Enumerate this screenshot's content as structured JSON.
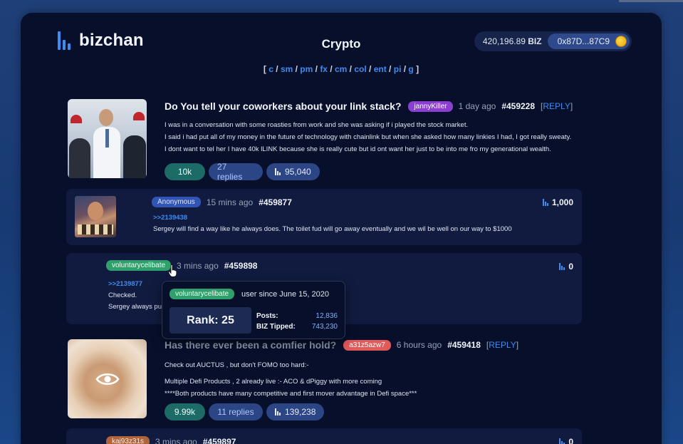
{
  "header": {
    "logo_text": "bizchan",
    "board_title": "Crypto",
    "nav": [
      "c",
      "sm",
      "pm",
      "fx",
      "cm",
      "col",
      "ent",
      "pi",
      "g"
    ],
    "wallet_balance": "420,196.89",
    "wallet_currency": "BIZ",
    "wallet_address": "0x87D...87C9"
  },
  "threads": [
    {
      "title": "Do You tell your coworkers about your link stack?",
      "author": "jannyKiller",
      "time": "1 day ago",
      "post_no": "#459228",
      "reply_label": "REPLY",
      "body": [
        "I was in a conversation with some roasties from work and she was asking if i played the stock market.",
        "I said i had put all of my money in the future of technology with chainlink but when she asked how many linkies I had, I got really sweaty.",
        "I dont want to tel her I have 40k lLINK because she is really cute but id ont want her just to be into me fro my generational wealth."
      ],
      "likes": "10k",
      "replies": "27 replies",
      "views": "95,040"
    },
    {
      "title": "Has there ever been a comfier hold?",
      "author": "a31z5azw7",
      "time": "6 hours ago",
      "post_no": "#459418",
      "reply_label": "REPLY",
      "body": [
        "Check out AUCTUS , but don't FOMO too hard:-",
        "",
        "Multiple Defi Products , 2 already live :- ACO & dPiggy with more coming",
        "****Both products have many competitive and first mover advantage in Defi space***"
      ],
      "likes": "9.99k",
      "replies": "11 replies",
      "views": "139,238"
    }
  ],
  "replies": [
    {
      "author": "Anonymous",
      "time": "15 mins ago",
      "post_no": "#459877",
      "quote": ">>2139438",
      "body": "Sergey will find a way like he always does. The toilet fud will go away eventually and we wil be well on our way to $1000",
      "views": "1,000"
    },
    {
      "author": "voluntarycelibate",
      "time": "3 mins ago",
      "post_no": "#459898",
      "quote": ">>2139877",
      "body_lines": [
        "Checked.",
        "Sergey always pul"
      ],
      "views": "0"
    },
    {
      "author": "kaj93z31s",
      "time": "3 mins ago",
      "post_no": "#459897",
      "views": "0"
    }
  ],
  "tooltip": {
    "username": "voluntarycelibate",
    "since": "user since June 15, 2020",
    "rank": "Rank: 25",
    "posts_label": "Posts:",
    "posts_value": "12,836",
    "tipped_label": "BIZ Tipped:",
    "tipped_value": "743,230"
  }
}
